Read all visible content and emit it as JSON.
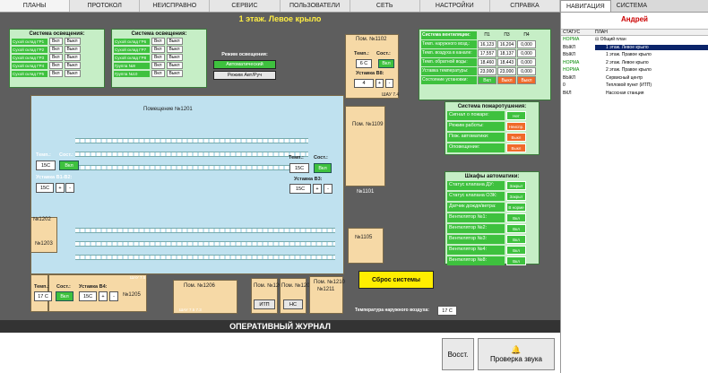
{
  "menu": [
    {
      "label": "ПЛАНЫ"
    },
    {
      "label": "ПРОТОКОЛ"
    },
    {
      "label": "НЕИСПРАВНО"
    },
    {
      "label": "СЕРВИС"
    },
    {
      "label": "ПОЛЬЗОВАТЕЛИ"
    },
    {
      "label": "СЕТЬ"
    },
    {
      "label": "НАСТРОЙКИ"
    },
    {
      "label": "СПРАВКА"
    }
  ],
  "nav_tabs": [
    {
      "label": "НАВИГАЦИЯ"
    },
    {
      "label": "СИСТЕМА"
    }
  ],
  "floor_title": "1 этаж. Левое крыло",
  "lighting1": {
    "title": "Система освещения:",
    "rows": [
      {
        "name": "Сухой склад ГР1",
        "on": "Вкл",
        "off": "Выкл"
      },
      {
        "name": "Сухой склад ГР2",
        "on": "Вкл",
        "off": "Выкл"
      },
      {
        "name": "Сухой склад ГР3",
        "on": "Вкл",
        "off": "Выкл"
      },
      {
        "name": "Сухой склад ГР4",
        "on": "Вкл",
        "off": "Выкл"
      },
      {
        "name": "Сухой склад ГР5",
        "on": "Вкл",
        "off": "Выкл"
      }
    ]
  },
  "lighting2": {
    "title": "Система освещения:",
    "rows": [
      {
        "name": "Сухой склад ГР6",
        "on": "Вкл",
        "off": "Выкл"
      },
      {
        "name": "Сухой склад ГР7",
        "on": "Вкл",
        "off": "Выкл"
      },
      {
        "name": "Сухой склад ГР8",
        "on": "Вкл",
        "off": "Выкл"
      },
      {
        "name": "Группа №9",
        "on": "Вкл",
        "off": "Выкл"
      },
      {
        "name": "Группа №10",
        "on": "Вкл",
        "off": "Выкл"
      }
    ]
  },
  "lighting_mode": {
    "title": "Режим освещения:",
    "auto": "Автоматический",
    "manual": "Режим Авт/Руч"
  },
  "rooms": {
    "r1102": "Пом. №1102",
    "r1201": "Помещение №1201",
    "r1109": "Пом. №1109",
    "r1101": "№1101",
    "r1105": "№1105",
    "r1202": "№1202",
    "r1203": "№1203",
    "r1205": "№1205",
    "r1206": "Пом. №1206",
    "r1208": "Пом. №1208",
    "r1209": "Пом. №1209",
    "r1210": "Пом. №1210",
    "r1211": "№1211",
    "shau74": "ШАУ 7.4",
    "shau75": "ШАУ 7.5",
    "shau7573": "ШАУ 7.5 7.3"
  },
  "r1102_controls": {
    "temp_label": "Темп.:",
    "state_label": "Сост.:",
    "temp": "6 С",
    "state": "Вкл",
    "setpoint_label": "Уставка В8:",
    "setpoint": "4"
  },
  "left_controls": {
    "temp_label": "Темп.:",
    "state_label": "Сост.:",
    "temp": "15С",
    "state": "Вкл",
    "setpoint_label": "Уставка В1-В2:",
    "setpoint": "15С"
  },
  "mid_controls": {
    "temp_label": "Темп.:",
    "state_label": "Сост.:",
    "temp": "15С",
    "state": "Вкл",
    "setpoint_label": "Уставка В3:",
    "setpoint": "15С"
  },
  "b_controls": {
    "temp_label": "Темп.:",
    "state_label": "Сост.:",
    "temp": "17 С",
    "state": "Вкл",
    "setpoint_label": "Уставка В4:",
    "setpoint": "15С"
  },
  "itp_label": "ИТП",
  "nc_label": "НС",
  "ventilation": {
    "title": "Система вентиляции:",
    "cols": [
      "П1",
      "П3",
      "П4"
    ],
    "rows": [
      {
        "label": "Темп. наружного возд.:",
        "vals": [
          "16,123",
          "16,204",
          "0,000"
        ]
      },
      {
        "label": "Темп. воздуха в канале:",
        "vals": [
          "17,557",
          "18,137",
          "0,000"
        ]
      },
      {
        "label": "Темп. обратной воды:",
        "vals": [
          "18,460",
          "18,443",
          "0,000"
        ]
      },
      {
        "label": "Уставка температуры:",
        "vals": [
          "23,000",
          "23,000",
          "0,000"
        ]
      }
    ],
    "state_label": "Состояние установки:",
    "state_vals": [
      "Вкл",
      "Выкл",
      "Выкл"
    ]
  },
  "fire": {
    "title": "Система пожаротушения:",
    "rows": [
      {
        "label": "Сигнал о пожаре:",
        "val": "Нет"
      },
      {
        "label": "Режим работы:",
        "val": "Неиспр."
      },
      {
        "label": "Пож. автоматики:",
        "val": "Выкл"
      },
      {
        "label": "Оповещение:",
        "val": "Выкл"
      }
    ]
  },
  "automation": {
    "title": "Шкафы автоматики:",
    "rows": [
      {
        "label": "Статус клапана ДУ:",
        "val": "Закрыт"
      },
      {
        "label": "Статус клапана ОЗК:",
        "val": "Закрыт"
      },
      {
        "label": "Датчик дождя/ветра:",
        "val": "В норме"
      },
      {
        "label": "Вентилятор №1:",
        "val": "Вкл"
      },
      {
        "label": "Вентилятор №2:",
        "val": "Вкл"
      },
      {
        "label": "Вентилятор №3:",
        "val": "Вкл"
      },
      {
        "label": "Вентилятор №4:",
        "val": "Вкл"
      },
      {
        "label": "Вентилятор №8:",
        "val": "Вкл"
      }
    ]
  },
  "reset_button": "Сброс системы",
  "outdoor": {
    "label": "Температура наружного воздуха:",
    "value": "17 С"
  },
  "journal_title": "ОПЕРАТИВНЫЙ ЖУРНАЛ",
  "restore_button": "Восст.",
  "sound_button": "Проверка звука",
  "user": "Андрей",
  "nav_headers": {
    "status": "СТАТУС",
    "plan": "ПЛАН"
  },
  "nav_rows": [
    {
      "status": "НОРМА",
      "plan": "⊟ Общий план"
    },
    {
      "status": "ВЫКЛ",
      "plan": "1 этаж. Левое крыло"
    },
    {
      "status": "ВЫКЛ",
      "plan": "1 этаж. Правое крыло"
    },
    {
      "status": "НОРМА",
      "plan": "2 этаж. Левое крыло"
    },
    {
      "status": "НОРМА",
      "plan": "2 этаж. Правое крыло"
    },
    {
      "status": "ВЫКЛ",
      "plan": "Сервисный центр"
    },
    {
      "status": "0",
      "plan": "Тепловой пункт (ИТП)"
    },
    {
      "status": "ВКЛ",
      "plan": "Насосная станция"
    }
  ]
}
